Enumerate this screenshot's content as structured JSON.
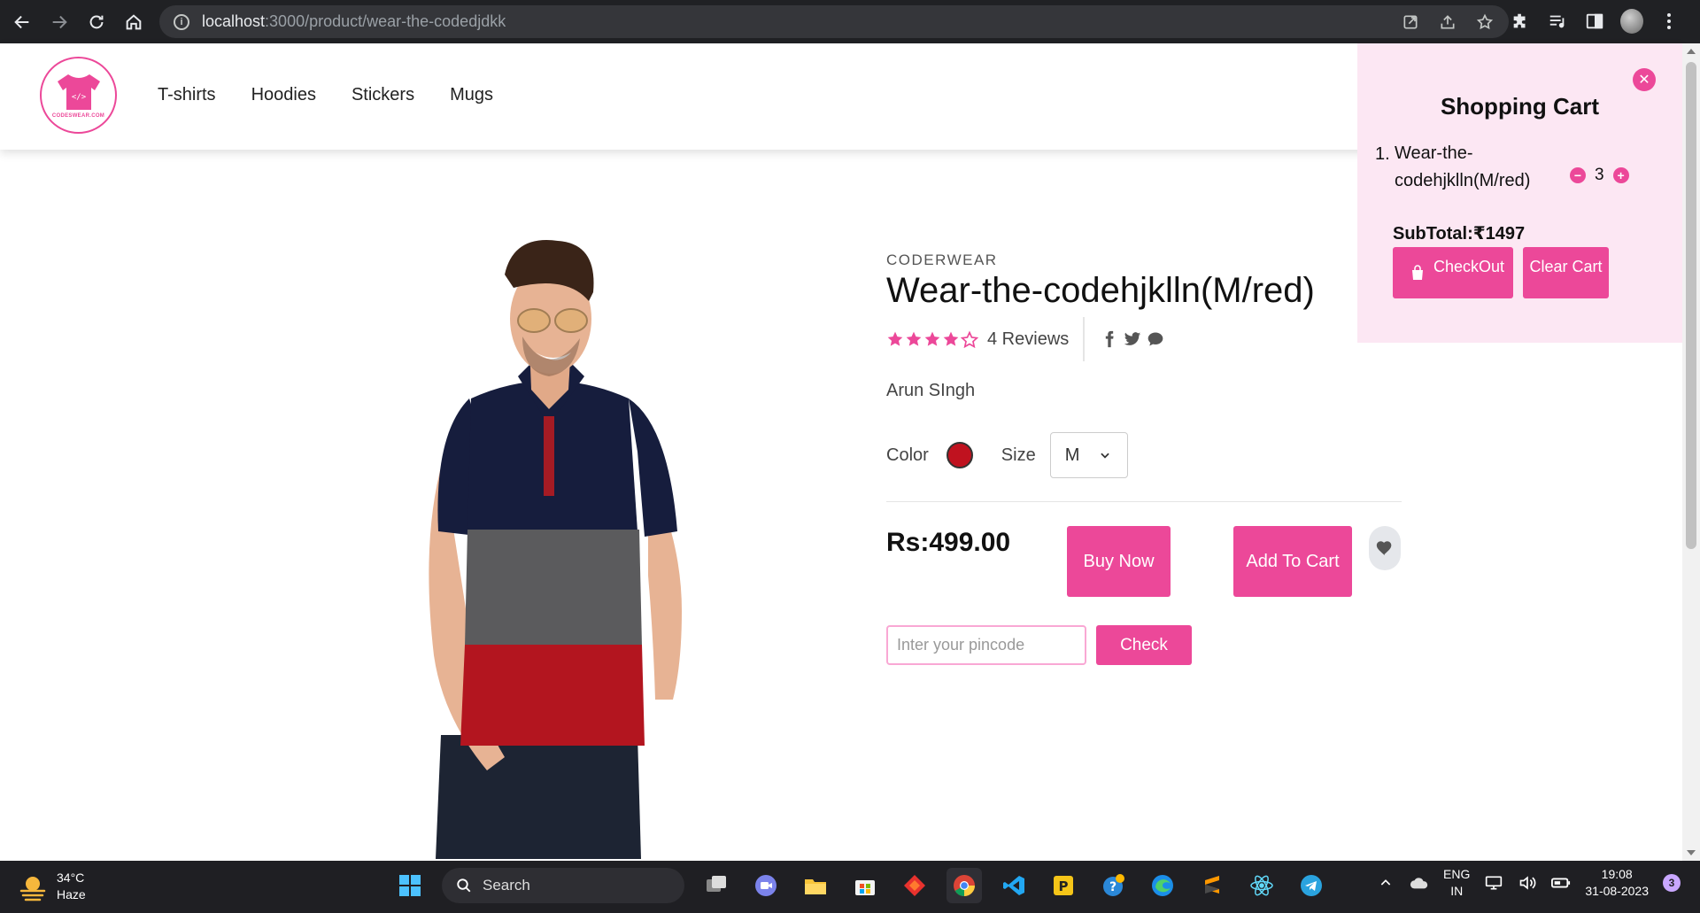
{
  "browser": {
    "url_host": "localhost",
    "url_path": ":3000/product/wear-the-codedjdkk"
  },
  "site": {
    "logo_text": "CODESWEAR.COM",
    "nav": [
      "T-shirts",
      "Hoodies",
      "Stickers",
      "Mugs"
    ]
  },
  "product": {
    "brand": "CODERWEAR",
    "title": "Wear-the-codehjklln(M/red)",
    "rating": 4,
    "rating_max": 5,
    "reviews": "4 Reviews",
    "seller": "Arun SIngh",
    "color_label": "Color",
    "color_value": "#c0121f",
    "size_label": "Size",
    "size_value": "M",
    "price": "Rs:499.00",
    "buy_now": "Buy Now",
    "add_to_cart": "Add To Cart",
    "pincode_placeholder": "Inter your pincode",
    "check": "Check"
  },
  "cart": {
    "title": "Shopping Cart",
    "items": [
      {
        "index": "1.",
        "name": "Wear-the-codehjklln(M/red)",
        "qty": "3"
      }
    ],
    "subtotal": "SubTotal:₹1497",
    "checkout": "CheckOut",
    "clear": "Clear Cart"
  },
  "taskbar": {
    "temp": "34°C",
    "weather": "Haze",
    "search": "Search",
    "lang_top": "ENG",
    "lang_bottom": "IN",
    "time": "19:08",
    "date": "31-08-2023",
    "notifications": "3"
  },
  "colors": {
    "accent": "#ec4899",
    "cart_bg": "#fce7f3"
  }
}
